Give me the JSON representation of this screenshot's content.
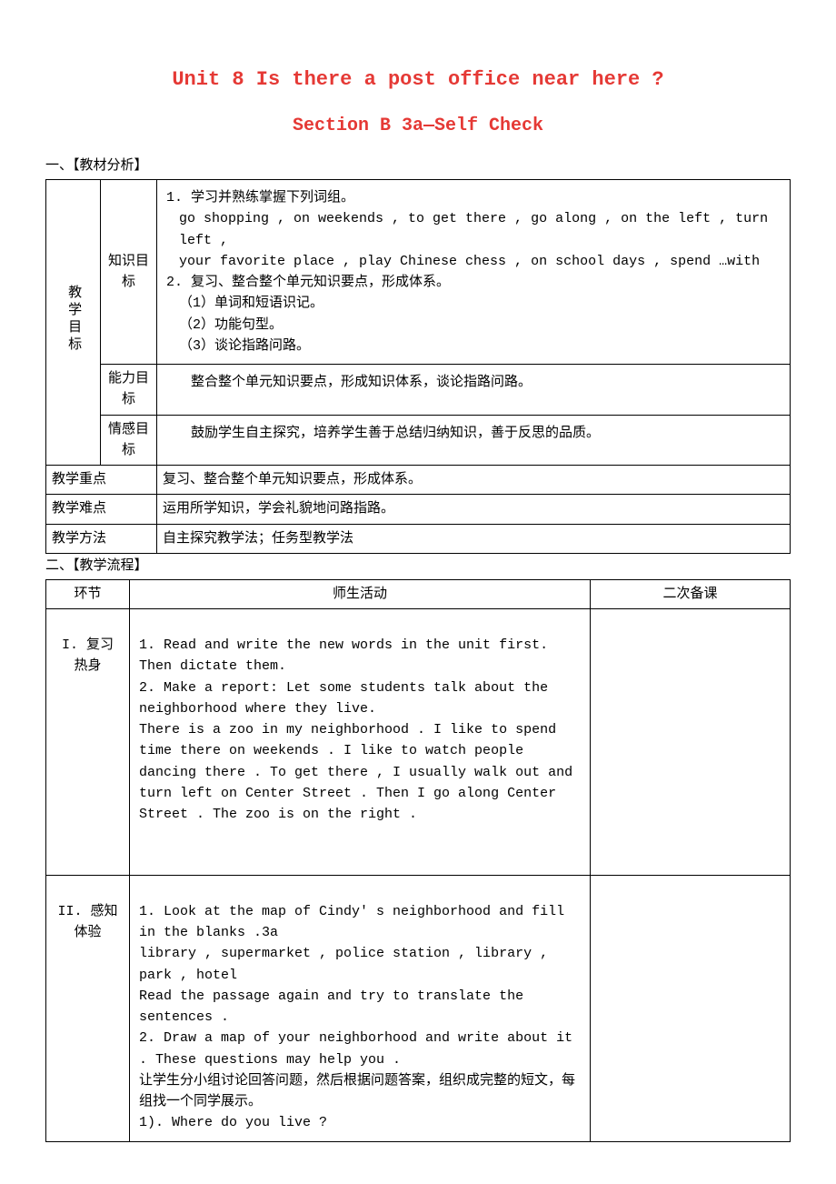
{
  "title1": "Unit 8 Is there a post office near here ?",
  "title2": "Section B 3a—Self Check",
  "sectionHeader1": "一、【教材分析】",
  "goals": {
    "rowLabel": "教学目标",
    "knowledge": {
      "label": "知识目标",
      "item1_num": "1.",
      "item1_title": "学习并熟练掌握下列词组。",
      "item1_line1": "go shopping , on weekends , to get there , go along , on the left , turn left ,",
      "item1_line2": "your favorite place , play Chinese chess , on school days , spend …with",
      "item2_num": "2.",
      "item2_title": "复习、整合整个单元知识要点，形成体系。",
      "item2_sub1": "（1）单词和短语识记。",
      "item2_sub2": "（2）功能句型。",
      "item2_sub3": "（3）谈论指路问路。"
    },
    "ability": {
      "label": "能力目标",
      "text": "整合整个单元知识要点，形成知识体系，谈论指路问路。"
    },
    "emotion": {
      "label": "情感目标",
      "text": "鼓励学生自主探究，培养学生善于总结归纳知识，善于反思的品质。"
    }
  },
  "keypoint": {
    "label": "教学重点",
    "text": "复习、整合整个单元知识要点，形成体系。"
  },
  "difficulty": {
    "label": "教学难点",
    "text": "运用所学知识，学会礼貌地问路指路。"
  },
  "method": {
    "label": "教学方法",
    "text": "自主探究教学法；任务型教学法"
  },
  "sectionHeader2": "二、【教学流程】",
  "flowHeaders": {
    "c1": "环节",
    "c2": "师生活动",
    "c3": "二次备课"
  },
  "flow1": {
    "label_line1": "I. 复习",
    "label_line2": "热身",
    "p1": "1. Read and write the new words in the unit first. Then dictate them.",
    "p2": "2. Make a report: Let some students talk about the neighborhood where they live.",
    "p3": "There is a zoo in my neighborhood . I like to spend time there on weekends . I like to watch people dancing there . To get there , I usually walk out and turn left on Center Street . Then I go along Center Street . The zoo is on the right ."
  },
  "flow2": {
    "label_line1": "II. 感知",
    "label_line2": "体验",
    "p1": "1. Look at the map of Cindy' s neighborhood and fill in the blanks .3a",
    "p2": "library , supermarket , police station , library , park , hotel",
    "p3": "Read the passage again and try to translate the sentences .",
    "p4": "2. Draw a map of your neighborhood and write about it . These questions may help you .",
    "p5": "让学生分小组讨论回答问题，然后根据问题答案，组织成完整的短文，每组找一个同学展示。",
    "p6": "1). Where do you live ?"
  }
}
